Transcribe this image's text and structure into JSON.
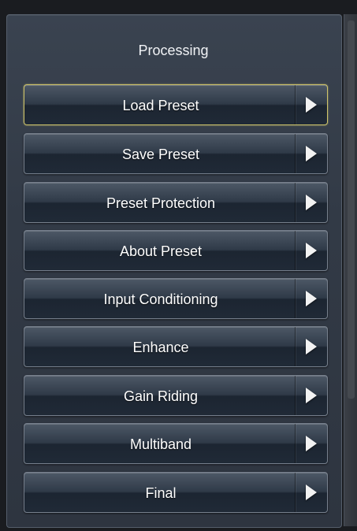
{
  "panel": {
    "title": "Processing"
  },
  "menu": {
    "items": [
      {
        "label": "Load Preset",
        "selected": true,
        "icon": "chevron-right-icon"
      },
      {
        "label": "Save Preset",
        "selected": false,
        "icon": "chevron-right-icon"
      },
      {
        "label": "Preset Protection",
        "selected": false,
        "icon": "chevron-right-icon"
      },
      {
        "label": "About Preset",
        "selected": false,
        "icon": "chevron-right-icon"
      },
      {
        "label": "Input Conditioning",
        "selected": false,
        "icon": "chevron-right-icon"
      },
      {
        "label": "Enhance",
        "selected": false,
        "icon": "chevron-right-icon"
      },
      {
        "label": "Gain Riding",
        "selected": false,
        "icon": "chevron-right-icon"
      },
      {
        "label": "Multiband",
        "selected": false,
        "icon": "chevron-right-icon"
      },
      {
        "label": "Final",
        "selected": false,
        "icon": "chevron-right-icon"
      }
    ]
  },
  "colors": {
    "selected_border": "#cfc46a",
    "button_border": "#77808d",
    "text": "#ffffff"
  }
}
